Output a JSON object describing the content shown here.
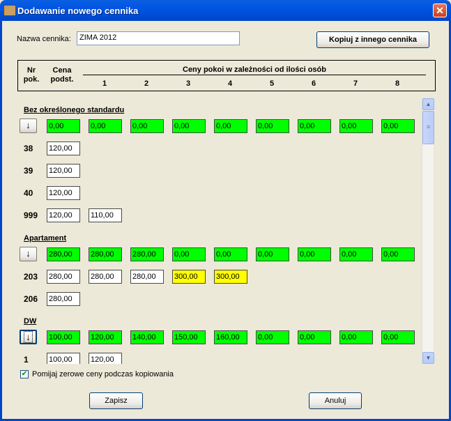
{
  "window": {
    "title": "Dodawanie nowego cennika",
    "close_glyph": "✕"
  },
  "form": {
    "name_label": "Nazwa cennika:",
    "name_value": "ZIMA 2012",
    "copy_button": "Kopiuj z innego cennika"
  },
  "header": {
    "nr": "Nr",
    "pok": "pok.",
    "cena": "Cena",
    "podst": "podst.",
    "group_title": "Ceny pokoi w zależności od ilości osób",
    "columns": [
      "1",
      "2",
      "3",
      "4",
      "5",
      "6",
      "7",
      "8"
    ]
  },
  "sections": [
    {
      "name": "Bez określonego standardu",
      "arrow": "↓",
      "defaults": [
        "0,00",
        "0,00",
        "0,00",
        "0,00",
        "0,00",
        "0,00",
        "0,00",
        "0,00",
        "0,00"
      ],
      "rows": [
        {
          "nr": "38",
          "base": "120,00",
          "prices": []
        },
        {
          "nr": "39",
          "base": "120,00",
          "prices": []
        },
        {
          "nr": "40",
          "base": "120,00",
          "prices": []
        },
        {
          "nr": "999",
          "base": "120,00",
          "prices": [
            "110,00"
          ]
        }
      ]
    },
    {
      "name": "Apartament",
      "arrow": "↓",
      "defaults": [
        "280,00",
        "280,00",
        "280,00",
        "0,00",
        "0,00",
        "0,00",
        "0,00",
        "0,00",
        "0,00"
      ],
      "rows": [
        {
          "nr": "203",
          "base": "280,00",
          "prices": [
            "280,00",
            "280,00",
            "300,00",
            "300,00"
          ]
        },
        {
          "nr": "206",
          "base": "280,00",
          "prices": []
        }
      ]
    },
    {
      "name": "DW",
      "arrow": "↓",
      "defaults": [
        "100,00",
        "120,00",
        "140,00",
        "150,00",
        "160,00",
        "0,00",
        "0,00",
        "0,00",
        "0,00"
      ],
      "rows": [
        {
          "nr": "1",
          "base": "100,00",
          "prices": [
            "120,00"
          ]
        }
      ]
    }
  ],
  "colors": {
    "default_cell": "#00FF00",
    "modified_cell": "#FFFF00",
    "plain_cell": "#FFFFFF"
  },
  "footer": {
    "ignore_zero_label": "Pomijaj zerowe ceny podczas kopiowania",
    "ignore_zero_checked": true,
    "checkbox_glyph": "✔",
    "save_button": "Zapisz",
    "cancel_button": "Anuluj"
  },
  "scrollbar": {
    "up_glyph": "▲",
    "down_glyph": "▼",
    "thumb_glyph": "≡"
  },
  "icons": {
    "title": "app-icon",
    "close": "close-icon",
    "arrow": "arrow-down-icon"
  }
}
